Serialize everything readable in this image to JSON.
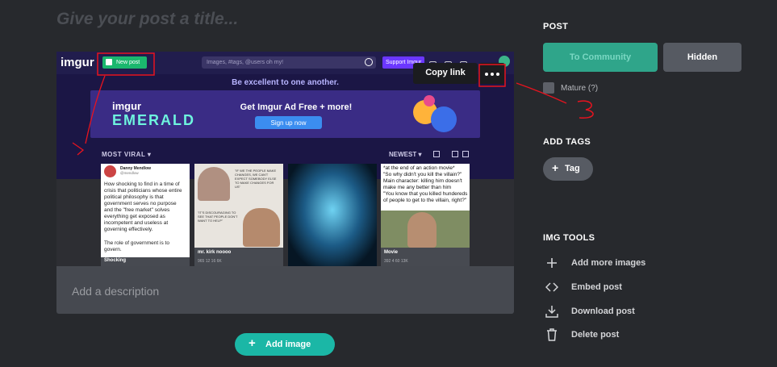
{
  "post": {
    "title_placeholder": "Give your post a title...",
    "description_placeholder": "Add a description",
    "add_image_label": "Add image"
  },
  "image": {
    "logo": "imgur",
    "new_post_label": "New post",
    "search_placeholder": "Images, #tags, @users oh my!",
    "support_label": "Support Imgur",
    "motto": "Be excellent to one another.",
    "banner": {
      "brand": "imgur",
      "product": "EMERALD",
      "headline": "Get Imgur Ad Free + more!",
      "cta": "Sign up now"
    },
    "feed_left": "MOST VIRAL",
    "feed_right": "NEWEST",
    "cards": [
      {
        "author": "Danny Mendlow",
        "handle": "@mendlow",
        "text": "How shocking to find in a time of crisis that politicians whose entire political philosophy is that government serves no purpose and the \"free market\" solves everything get exposed as incompetent and useless at governing effectively.",
        "text2": "The role of government is to govern.",
        "title": "Shocking"
      },
      {
        "quote1": "\"IF WE THE PEOPLE MAKE CHANGES, WE CAN'T EXPECT SOMEBODY ELSE TO MAKE CHANGES FOR US\"",
        "quote2": "\"IT'S DISCOURAGING TO SEE THAT PEOPLE DON'T WANT TO HELP\"",
        "title": "mr. kirk noooo",
        "stats": "965   12   16   6K"
      },
      {
        "title": ""
      },
      {
        "text1": "*at the end of an action movie*",
        "text2": "\"So why didn't you kill the villain?\"",
        "text3": "Main character: killing him doesn't make me any better than him",
        "text4": "\"You know that you killed hundereds of people to get to the villain, right?\"",
        "title": "Movie",
        "stats": "392   4   60   13K"
      }
    ]
  },
  "popup": {
    "tooltip": "Copy link",
    "more_icon": "more-dots-icon"
  },
  "sidebar": {
    "post_heading": "POST",
    "to_community": "To Community",
    "hidden": "Hidden",
    "mature": "Mature (?)",
    "tags_heading": "ADD TAGS",
    "tag_button": "Tag",
    "tools_heading": "IMG TOOLS",
    "tools": [
      {
        "label": "Add more images",
        "icon": "plus-icon"
      },
      {
        "label": "Embed post",
        "icon": "code-icon"
      },
      {
        "label": "Download post",
        "icon": "download-icon"
      },
      {
        "label": "Delete post",
        "icon": "trash-icon"
      }
    ]
  },
  "annotations": {
    "mark1": "1",
    "mark3": "3"
  },
  "colors": {
    "background": "#27292d",
    "accent_green": "#1bb7a6",
    "community_green": "#2fa58a",
    "annotation_red": "#e8131f"
  }
}
